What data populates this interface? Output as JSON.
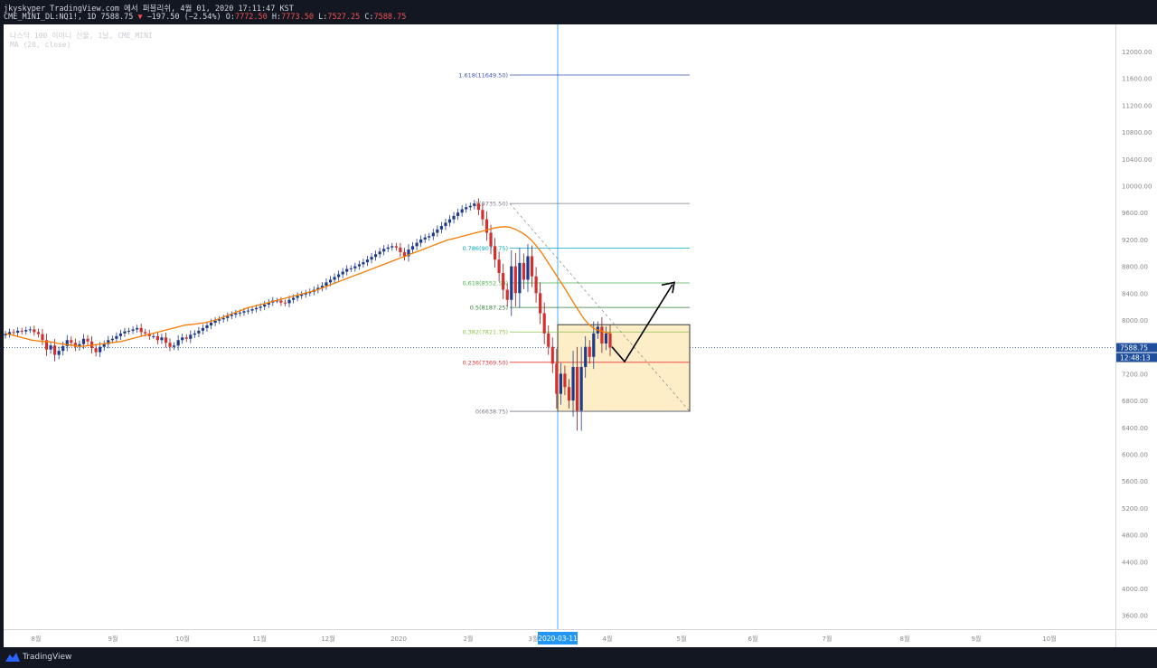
{
  "header": {
    "publish_line": "jkyskyper TradingView.com 에서 퍼블리쉬, 4월 01, 2020 17:11:47 KST",
    "symbol": "CME_MINI_DL:NQ1!, 1D",
    "last": "7588.75",
    "change": "−197.50 (−2.54%)",
    "o_label": "O:",
    "o": "7772.50",
    "h_label": "H:",
    "h": "7773.50",
    "l_label": "L:",
    "l": "7527.25",
    "c_label": "C:",
    "c": "7588.75"
  },
  "legend": {
    "title": "나스닥 100 이미니 선물, 1날, CME_MINI",
    "ma": "MA (20, close)"
  },
  "price_axis": {
    "last_price_label": "7588.75",
    "countdown_label": "12:48:13"
  },
  "time_axis": {
    "crosshair_label": "2020-03-11"
  },
  "footer": {
    "brand": "TradingView"
  },
  "colors": {
    "up": "#26a69a",
    "down_body": "#d32f2f",
    "up_body": "#1e3a8a",
    "ma": "#f57c00",
    "crosshair": "#2196f3",
    "box_fill": "#fdeec8"
  },
  "chart_data": {
    "type": "candlestick",
    "y_ticks": [
      "3600.00",
      "4000.00",
      "4400.00",
      "4800.00",
      "5200.00",
      "5600.00",
      "6000.00",
      "6400.00",
      "6800.00",
      "7200.00",
      "7600.00",
      "8000.00",
      "8400.00",
      "8800.00",
      "9200.00",
      "9600.00",
      "10000.00",
      "10400.00",
      "10800.00",
      "11200.00",
      "11600.00",
      "12000.00"
    ],
    "ylim": [
      3300,
      12500
    ],
    "x_ticks": [
      "8월",
      "9월",
      "10월",
      "11월",
      "12월",
      "2020",
      "2월",
      "3월",
      "4월",
      "5월",
      "6월",
      "7월",
      "8월",
      "9월",
      "10월"
    ],
    "crosshair_date": "2020-03-11",
    "current_price": 7588.75,
    "fib_levels": [
      {
        "label": "1.618(11649.50)",
        "value": 11649.5,
        "color": "#3f51b5"
      },
      {
        "label": "1(9735.50)",
        "value": 9735.5,
        "color": "#787b86"
      },
      {
        "label": "0.786(9072.75)",
        "value": 9072.75,
        "color": "#00acc1"
      },
      {
        "label": "0.618(8552.50)",
        "value": 8552.5,
        "color": "#4caf50"
      },
      {
        "label": "0.5(8187.25)",
        "value": 8187.25,
        "color": "#2e7d32"
      },
      {
        "label": "0.382(7821.75)",
        "value": 7821.75,
        "color": "#8bc34a"
      },
      {
        "label": "0.236(7369.50)",
        "value": 7369.5,
        "color": "#e53935"
      },
      {
        "label": "0(6638.75)",
        "value": 6638.75,
        "color": "#787b86"
      }
    ],
    "close_series": [
      7790,
      7820,
      7810,
      7840,
      7830,
      7850,
      7860,
      7820,
      7790,
      7700,
      7560,
      7620,
      7480,
      7540,
      7610,
      7700,
      7660,
      7600,
      7640,
      7720,
      7680,
      7580,
      7520,
      7600,
      7640,
      7700,
      7720,
      7760,
      7800,
      7830,
      7840,
      7860,
      7880,
      7820,
      7800,
      7760,
      7760,
      7700,
      7740,
      7660,
      7600,
      7620,
      7700,
      7740,
      7720,
      7780,
      7800,
      7840,
      7880,
      7920,
      7960,
      7990,
      8010,
      8030,
      8060,
      8080,
      8100,
      8110,
      8130,
      8140,
      8160,
      8180,
      8200,
      8230,
      8260,
      8290,
      8290,
      8260,
      8250,
      8300,
      8330,
      8360,
      8380,
      8400,
      8420,
      8450,
      8480,
      8510,
      8560,
      8600,
      8640,
      8680,
      8720,
      8760,
      8770,
      8800,
      8830,
      8860,
      8900,
      8940,
      8980,
      9020,
      9060,
      9080,
      9100,
      9080,
      9010,
      8950,
      9050,
      9100,
      9150,
      9200,
      9230,
      9250,
      9300,
      9350,
      9400,
      9450,
      9500,
      9550,
      9600,
      9650,
      9680,
      9700,
      9735,
      9640,
      9500,
      9300,
      9100,
      8900,
      8700,
      8450,
      8300,
      8800,
      8400,
      8850,
      8600,
      8950,
      8650,
      8400,
      8100,
      7800,
      7600,
      7350,
      6900,
      7200,
      7000,
      6800,
      7300,
      6650,
      7300,
      7600,
      7450,
      7800,
      7900,
      7650,
      7800,
      7589
    ],
    "ma_series": [
      7800,
      7780,
      7760,
      7740,
      7720,
      7700,
      7690,
      7680,
      7680,
      7670,
      7650,
      7640,
      7630,
      7620,
      7610,
      7610,
      7620,
      7630,
      7640,
      7650,
      7660,
      7670,
      7680,
      7700,
      7720,
      7740,
      7760,
      7780,
      7800,
      7820,
      7840,
      7860,
      7880,
      7900,
      7920,
      7930,
      7940,
      7950,
      7960,
      7980,
      8000,
      8030,
      8060,
      8090,
      8120,
      8150,
      8180,
      8200,
      8220,
      8240,
      8260,
      8280,
      8300,
      8320,
      8340,
      8360,
      8380,
      8400,
      8420,
      8440,
      8470,
      8500,
      8530,
      8560,
      8590,
      8620,
      8650,
      8680,
      8710,
      8740,
      8770,
      8800,
      8830,
      8860,
      8890,
      8920,
      8950,
      8980,
      9010,
      9040,
      9070,
      9100,
      9130,
      9160,
      9190,
      9210,
      9230,
      9250,
      9270,
      9290,
      9310,
      9330,
      9350,
      9370,
      9385,
      9390,
      9380,
      9350,
      9310,
      9260,
      9190,
      9100,
      9000,
      8880,
      8760,
      8640,
      8520,
      8390,
      8260,
      8140,
      8020,
      7930,
      7870,
      7840,
      7820,
      7800
    ],
    "annotation": "rectangle box spanning from 2020-03-11 to forecast, 6638.75–7930, with zig-zag arrow forecast"
  }
}
